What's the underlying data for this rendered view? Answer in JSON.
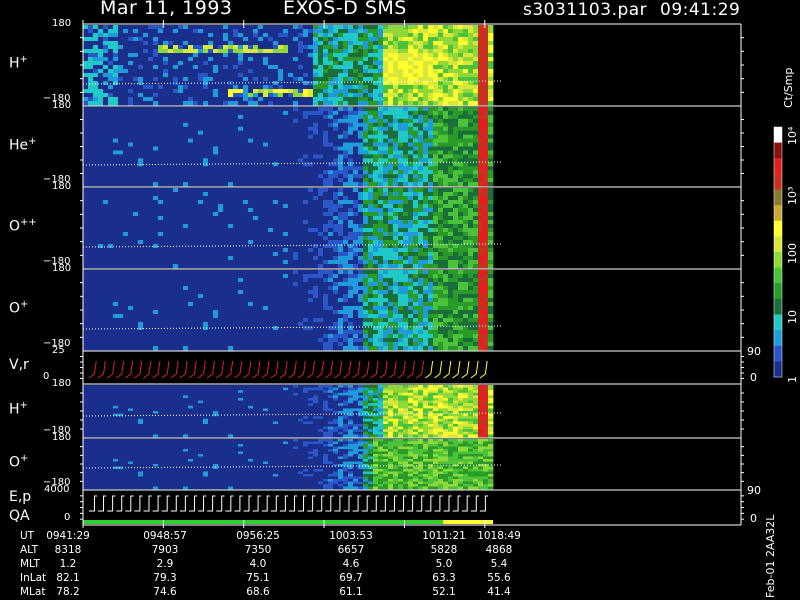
{
  "header": {
    "date": "Mar 11, 1993",
    "mission": "EXOS-D SMS",
    "file": "s3031103.par",
    "time": "09:41:29"
  },
  "colors": {
    "background": "#000000",
    "panel_fill": "#1a2f8c",
    "axis": "#ffffff",
    "vr_trace": "#e02020",
    "vr_trace_late": "#ffff40",
    "qa_good": "#30d030",
    "qa_warn": "#ffff30"
  },
  "colorbar": {
    "unit": "Ct/Smp",
    "scale": "log",
    "range": [
      1,
      10000
    ],
    "ticks": [
      "1",
      "10",
      "100",
      "10³",
      "10⁴"
    ],
    "tick_values": [
      1,
      10,
      100,
      1000,
      10000
    ],
    "colors": [
      "#1a2f8c",
      "#2a56c8",
      "#1f9bd9",
      "#20c8c8",
      "#1a6e3a",
      "#2a9a2a",
      "#4cc23a",
      "#8ed83a",
      "#d8e83a",
      "#ffff30",
      "#c8a830",
      "#8a7a30",
      "#c83020",
      "#e02020",
      "#8a1010",
      "#ffffff"
    ]
  },
  "chart_data": {
    "type": "heatmap",
    "x_axis": {
      "label": "UT",
      "ticks": [
        "0941:29",
        "0948:57",
        "0956:25",
        "1003:53",
        "1011:21",
        "1018:49"
      ]
    },
    "panels": [
      {
        "label": "H",
        "charge": "+",
        "yticks": [
          "180",
          "−180"
        ],
        "ylim": [
          -180,
          180
        ],
        "type": "heatmap",
        "profile": "h1"
      },
      {
        "label": "He",
        "charge": "+",
        "yticks": [
          "180",
          "−180"
        ],
        "ylim": [
          -180,
          180
        ],
        "type": "heatmap",
        "profile": "he"
      },
      {
        "label": "O",
        "charge": "++",
        "yticks": [
          "180",
          "−180"
        ],
        "ylim": [
          -180,
          180
        ],
        "type": "heatmap",
        "profile": "opp"
      },
      {
        "label": "O",
        "charge": "+",
        "yticks": [
          "180",
          "−180"
        ],
        "ylim": [
          -180,
          180
        ],
        "type": "heatmap",
        "profile": "op"
      },
      {
        "label": "V,r",
        "charge": "",
        "yticks": [
          "25",
          "0"
        ],
        "ylim": [
          0,
          25
        ],
        "right_ticks": [
          "90",
          "0"
        ],
        "type": "line",
        "profile": "vr"
      },
      {
        "label": "H",
        "charge": "+",
        "yticks": [
          "180",
          "−180"
        ],
        "ylim": [
          -180,
          180
        ],
        "type": "heatmap",
        "profile": "h2"
      },
      {
        "label": "O",
        "charge": "+",
        "yticks": [
          "180",
          "−180"
        ],
        "ylim": [
          -180,
          180
        ],
        "type": "heatmap",
        "profile": "o2"
      },
      {
        "label": "E,p",
        "label2": "QA",
        "charge": "",
        "yticks": [
          "4000",
          "0"
        ],
        "ylim": [
          0,
          4000
        ],
        "right_ticks": [
          "90",
          "0"
        ],
        "type": "line",
        "profile": "ep"
      }
    ],
    "orbit_table": {
      "rows": [
        {
          "name": "UT",
          "values": [
            "0941:29",
            "0948:57",
            "0956:25",
            "1003:53",
            "1011:21",
            "1018:49"
          ]
        },
        {
          "name": "ALT",
          "values": [
            "8318",
            "7903",
            "7350",
            "6657",
            "5828",
            "4868"
          ]
        },
        {
          "name": "MLT",
          "values": [
            "1.2",
            "2.9",
            "4.0",
            "4.6",
            "5.0",
            "5.4"
          ]
        },
        {
          "name": "InLat",
          "values": [
            "82.1",
            "79.3",
            "75.1",
            "69.7",
            "63.3",
            "55.6"
          ]
        },
        {
          "name": "MLat",
          "values": [
            "78.2",
            "74.6",
            "68.6",
            "61.1",
            "52.1",
            "41.4"
          ]
        }
      ]
    }
  },
  "footer": "Feb-01 2AA32L"
}
